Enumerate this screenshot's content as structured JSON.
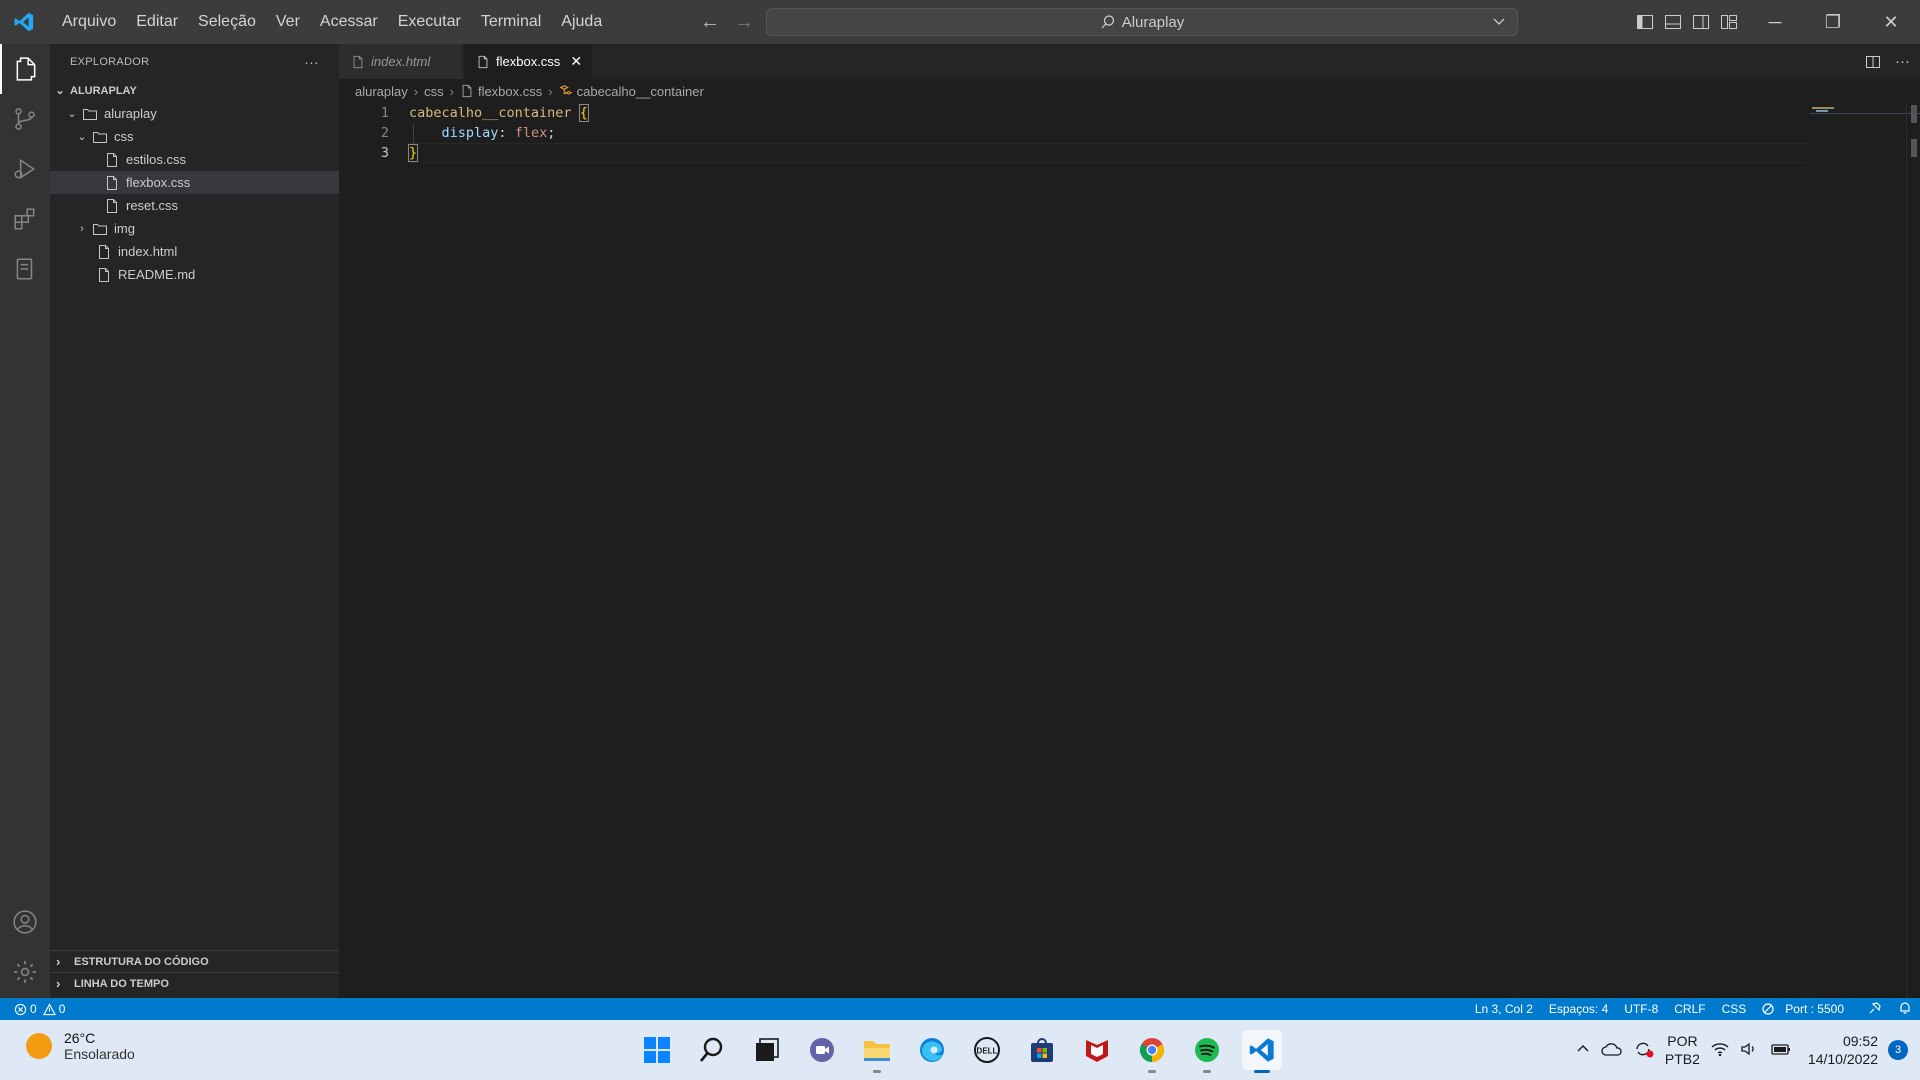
{
  "titlebar": {
    "menu": [
      "Arquivo",
      "Editar",
      "Seleção",
      "Ver",
      "Acessar",
      "Executar",
      "Terminal",
      "Ajuda"
    ],
    "search": "Aluraplay"
  },
  "sidebar": {
    "title": "EXPLORADOR",
    "more": "···",
    "root": "ALURAPLAY",
    "tree": [
      {
        "label": "aluraplay",
        "type": "folder",
        "open": true
      },
      {
        "label": "css",
        "type": "folder",
        "open": true
      },
      {
        "label": "estilos.css",
        "type": "file"
      },
      {
        "label": "flexbox.css",
        "type": "file",
        "selected": true
      },
      {
        "label": "reset.css",
        "type": "file"
      },
      {
        "label": "img",
        "type": "folder",
        "open": false
      },
      {
        "label": "index.html",
        "type": "file"
      },
      {
        "label": "README.md",
        "type": "file"
      }
    ],
    "sections": [
      "ESTRUTURA DO CÓDIGO",
      "LINHA DO TEMPO"
    ]
  },
  "tabs": [
    {
      "label": "index.html",
      "active": false
    },
    {
      "label": "flexbox.css",
      "active": true,
      "close": "✕"
    }
  ],
  "breadcrumb": {
    "parts": [
      "aluraplay",
      "css",
      "flexbox.css",
      "cabecalho__container"
    ]
  },
  "editor": {
    "line_numbers": [
      "1",
      "2",
      "3"
    ],
    "lines": {
      "l1_selector": "cabecalho__container",
      "l1_brace": "{",
      "l2_prop": "display",
      "l2_colon": ": ",
      "l2_value": "flex",
      "l2_semi": ";",
      "l3_brace": "}"
    }
  },
  "statusbar": {
    "errors": "0",
    "warnings": "0",
    "position": "Ln 3, Col 2",
    "spaces": "Espaços: 4",
    "encoding": "UTF-8",
    "eol": "CRLF",
    "language": "CSS",
    "port": "Port : 5500"
  },
  "taskbar": {
    "weather_temp": "26°C",
    "weather_desc": "Ensolarado",
    "lang_top": "POR",
    "lang_bottom": "PTB2",
    "time": "09:52",
    "date": "14/10/2022",
    "notifications": "3"
  },
  "colors": {
    "accent": "#007acc",
    "selector": "#d7ba7d",
    "property": "#9cdcfe",
    "value": "#ce9178"
  }
}
